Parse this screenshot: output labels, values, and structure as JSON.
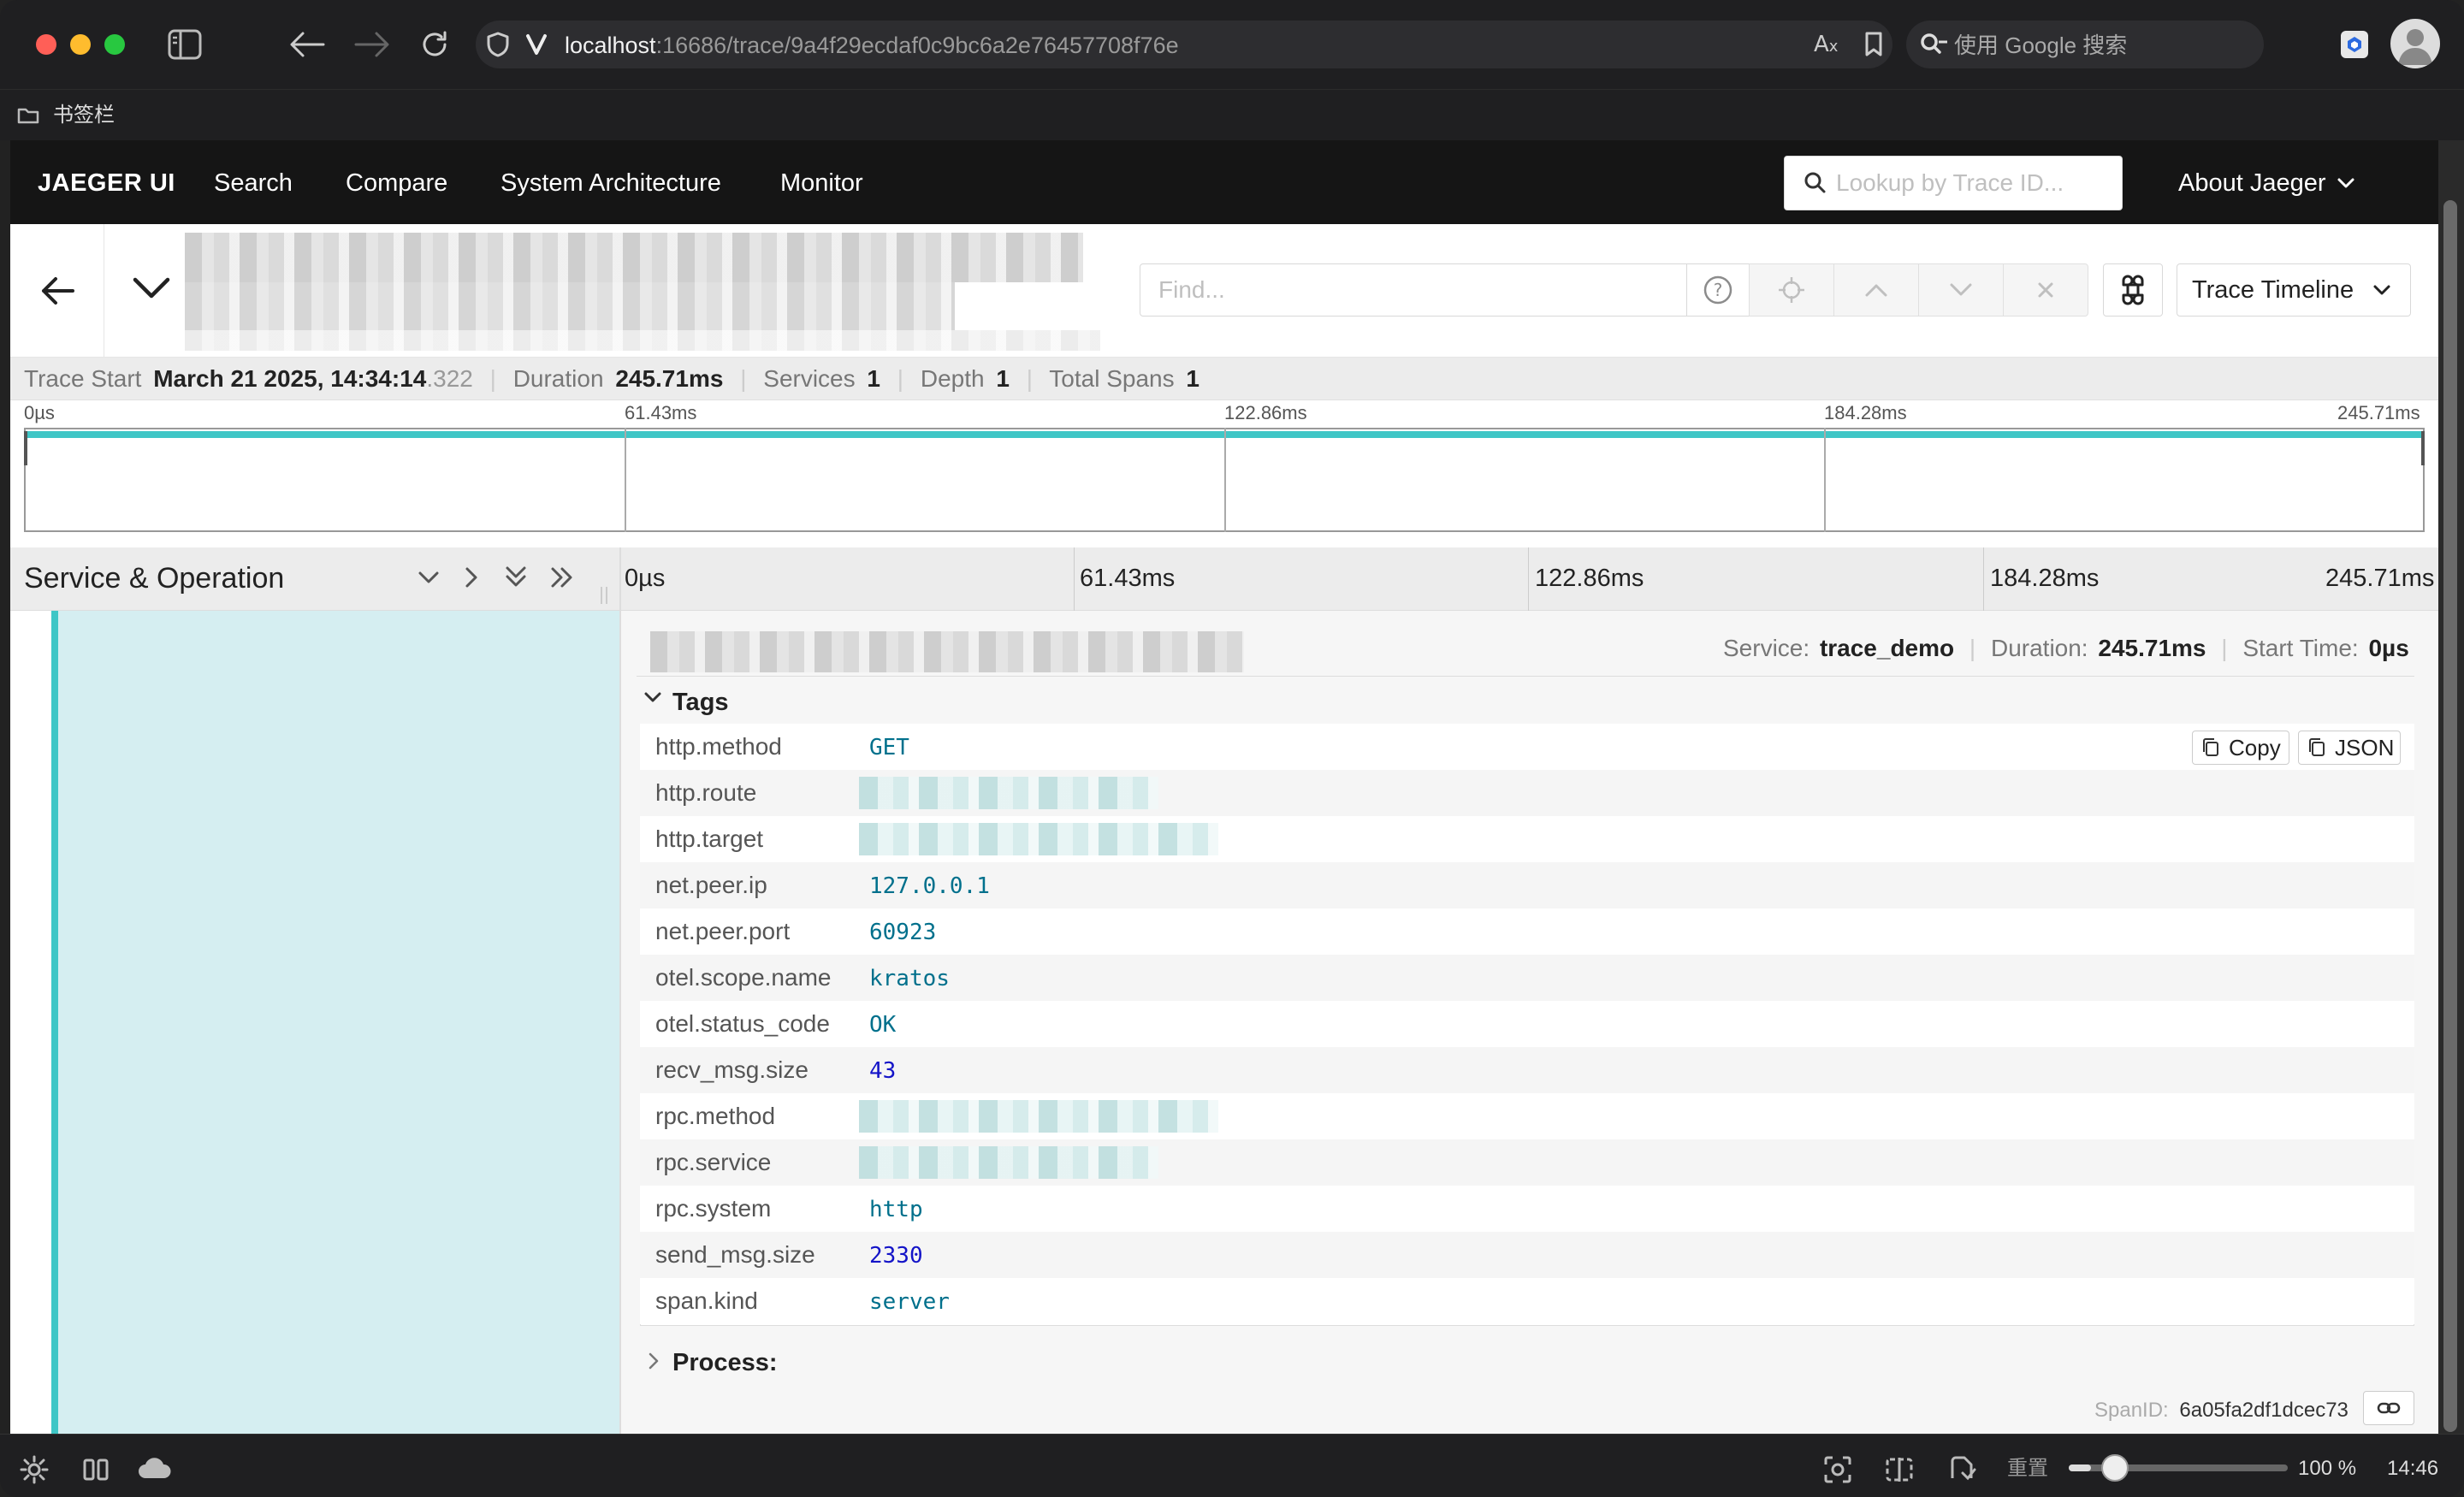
{
  "browser": {
    "url_host": "localhost",
    "url_rest": ":16686/trace/9a4f29ecdaf0c9bc6a2e76457708f76e",
    "search_placeholder": "使用 Google 搜索",
    "bookmarks_label": "书签栏"
  },
  "nav": {
    "brand": "JAEGER UI",
    "items": [
      "Search",
      "Compare",
      "System Architecture",
      "Monitor"
    ],
    "lookup_placeholder": "Lookup by Trace ID...",
    "about": "About Jaeger"
  },
  "header": {
    "find_placeholder": "Find...",
    "view_select": "Trace Timeline"
  },
  "summary": {
    "trace_start_label": "Trace Start",
    "trace_start_value": "March 21 2025, 14:34:14",
    "trace_start_ms": ".322",
    "duration_label": "Duration",
    "duration_value": "245.71ms",
    "services_label": "Services",
    "services_value": "1",
    "depth_label": "Depth",
    "depth_value": "1",
    "total_spans_label": "Total Spans",
    "total_spans_value": "1"
  },
  "minimap": {
    "ticks": [
      "0µs",
      "61.43ms",
      "122.86ms",
      "184.28ms",
      "245.71ms"
    ],
    "span_fill": 1.0
  },
  "timeline": {
    "left_title": "Service & Operation",
    "ticks": [
      "0µs",
      "61.43ms",
      "122.86ms",
      "184.28ms",
      "245.71ms"
    ]
  },
  "detail": {
    "service_label": "Service:",
    "service_value": "trace_demo",
    "duration_label": "Duration:",
    "duration_value": "245.71ms",
    "start_label": "Start Time:",
    "start_value": "0µs",
    "tags_title": "Tags",
    "copy_label": "Copy",
    "json_label": "JSON",
    "tags": [
      {
        "key": "http.method",
        "value": "GET",
        "kind": "str"
      },
      {
        "key": "http.route",
        "value": "",
        "kind": "redacted"
      },
      {
        "key": "http.target",
        "value": "",
        "kind": "redacted"
      },
      {
        "key": "net.peer.ip",
        "value": "127.0.0.1",
        "kind": "str"
      },
      {
        "key": "net.peer.port",
        "value": "60923",
        "kind": "str"
      },
      {
        "key": "otel.scope.name",
        "value": "kratos",
        "kind": "str"
      },
      {
        "key": "otel.status_code",
        "value": "OK",
        "kind": "str"
      },
      {
        "key": "recv_msg.size",
        "value": "43",
        "kind": "num"
      },
      {
        "key": "rpc.method",
        "value": "",
        "kind": "redacted"
      },
      {
        "key": "rpc.service",
        "value": "",
        "kind": "redacted"
      },
      {
        "key": "rpc.system",
        "value": "http",
        "kind": "str"
      },
      {
        "key": "send_msg.size",
        "value": "2330",
        "kind": "num"
      },
      {
        "key": "span.kind",
        "value": "server",
        "kind": "str"
      }
    ],
    "process_title": "Process:",
    "span_id_label": "SpanID:",
    "span_id_value": "6a05fa2df1dcec73"
  },
  "statusbar": {
    "reset_label": "重置",
    "zoom": "100 %",
    "zoom_level": 0.1,
    "time": "14:46"
  },
  "colors": {
    "nav_bg": "#151515",
    "span_teal": "#3fc6c6",
    "tag_str": "#00708c",
    "tag_num": "#1414c8"
  }
}
